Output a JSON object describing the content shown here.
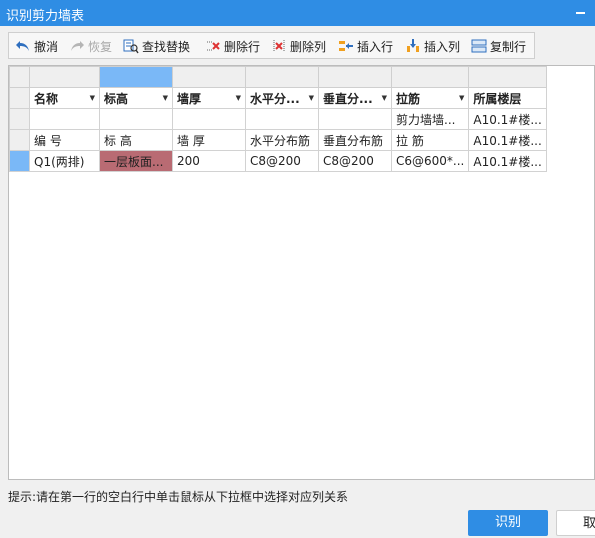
{
  "window": {
    "title": "识别剪力墙表"
  },
  "toolbar": {
    "undo": "撤消",
    "redo": "恢复",
    "find_replace": "查找替换",
    "delete_row": "删除行",
    "delete_col": "删除列",
    "insert_row": "插入行",
    "insert_col": "插入列",
    "copy_row": "复制行"
  },
  "grid": {
    "dropdown_row": [
      "名称",
      "标高",
      "墙厚",
      "水平分...",
      "垂直分...",
      "拉筋",
      "所属楼层"
    ],
    "row_type": [
      "",
      "",
      "",
      "",
      "",
      "剪力墙墙...",
      "A10.1#楼..."
    ],
    "row_header": [
      "编 号",
      "标 高",
      "墙 厚",
      "水平分布筋",
      "垂直分布筋",
      "拉 筋",
      "A10.1#楼..."
    ],
    "row_data": [
      "Q1(两排)",
      "一层板面...",
      "200",
      "C8@200",
      "C8@200",
      "C6@600*...",
      "A10.1#楼..."
    ]
  },
  "hint": "提示:请在第一行的空白行中单击鼠标从下拉框中选择对应列关系",
  "buttons": {
    "ok": "识别",
    "cancel": "取"
  },
  "colors": {
    "accent": "#2f8de4",
    "selected_col": "#7ab8f7",
    "highlight_cell": "#b96b73"
  }
}
